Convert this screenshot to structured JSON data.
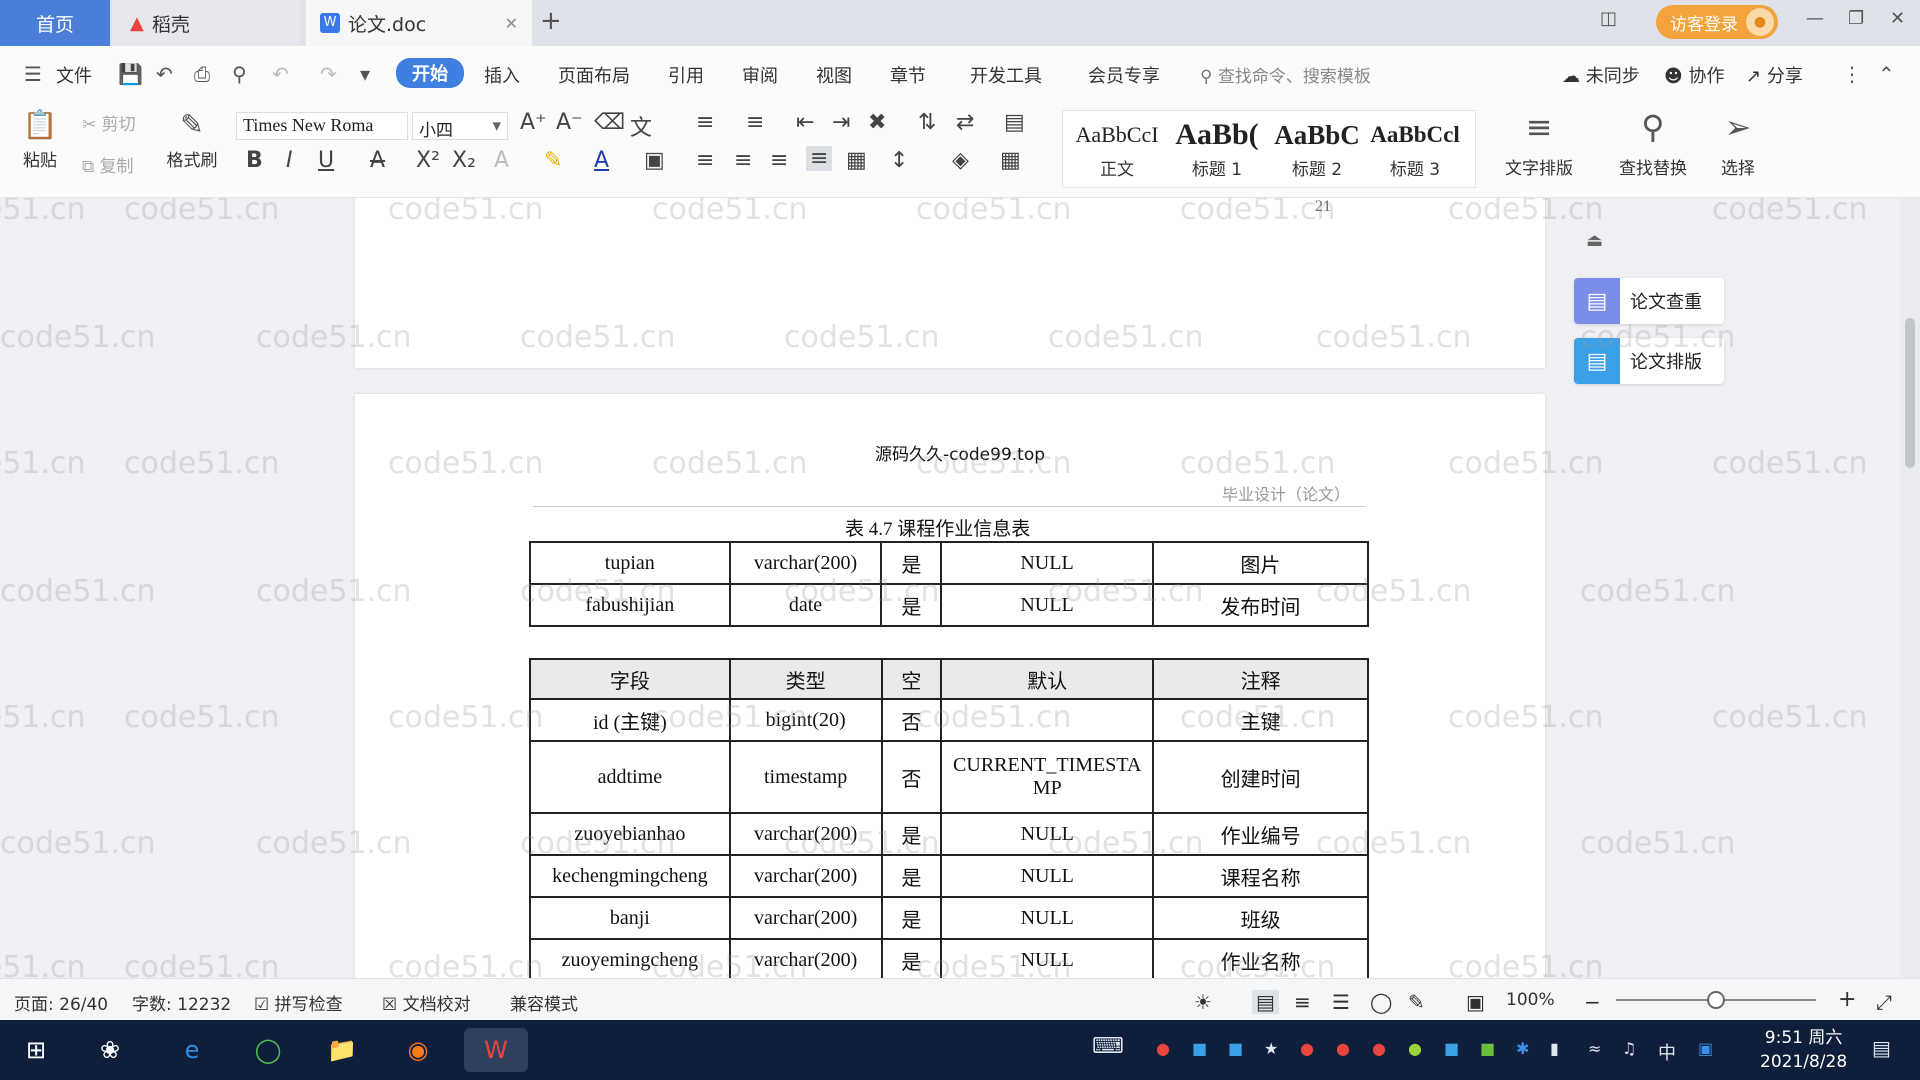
{
  "tabs": [
    {
      "label": "首页"
    },
    {
      "label": "稻壳"
    },
    {
      "label": "论文.doc"
    }
  ],
  "login_label": "访客登录",
  "menu": {
    "file": "文件",
    "items": [
      "开始",
      "插入",
      "页面布局",
      "引用",
      "审阅",
      "视图",
      "章节",
      "开发工具",
      "会员专享"
    ],
    "active": "开始",
    "search_placeholder": "查找命令、搜索模板",
    "sync": "未同步",
    "collab": "协作",
    "share": "分享"
  },
  "ribbon": {
    "paste": "粘贴",
    "cut": "剪切",
    "copy": "复制",
    "format_painter": "格式刷",
    "font_name": "Times New Roma",
    "font_size": "小四",
    "styles": [
      {
        "preview": "AaBbCcI",
        "name": "正文"
      },
      {
        "preview": "AaBb(",
        "name": "标题 1"
      },
      {
        "preview": "AaBbC",
        "name": "标题 2"
      },
      {
        "preview": "AaBbCcl",
        "name": "标题 3"
      }
    ],
    "text_layout": "文字排版",
    "find_replace": "查找替换",
    "select": "选择"
  },
  "document": {
    "page_number": "21",
    "header": "毕业设计（论文）",
    "overlay_text": "源码久久-code99.top",
    "watermark": "code51.cn",
    "top_table_rows": [
      [
        "tupian",
        "varchar(200)",
        "是",
        "NULL",
        "图片"
      ],
      [
        "fabushijian",
        "date",
        "是",
        "NULL",
        "发布时间"
      ]
    ],
    "caption": "表 4.7  课程作业信息表",
    "table_header": [
      "字段",
      "类型",
      "空",
      "默认",
      "注释"
    ],
    "table_rows": [
      [
        "id (主键)",
        "bigint(20)",
        "否",
        "",
        "主键"
      ],
      [
        "addtime",
        "timestamp",
        "否",
        "CURRENT_TIMESTAMP",
        "创建时间"
      ],
      [
        "zuoyebianhao",
        "varchar(200)",
        "是",
        "NULL",
        "作业编号"
      ],
      [
        "kechengmingcheng",
        "varchar(200)",
        "是",
        "NULL",
        "课程名称"
      ],
      [
        "banji",
        "varchar(200)",
        "是",
        "NULL",
        "班级"
      ],
      [
        "zuoyemingcheng",
        "varchar(200)",
        "是",
        "NULL",
        "作业名称"
      ]
    ],
    "default_line1": "CURRENT_TIMESTA",
    "default_line2": "MP"
  },
  "side_panel": {
    "check": "论文查重",
    "layout": "论文排版"
  },
  "status": {
    "page": "页面: 26/40",
    "words": "字数: 12232",
    "spell": "拼写检查",
    "proof": "文档校对",
    "compat": "兼容模式",
    "zoom": "100%",
    "zoom_level": 0.5
  },
  "taskbar": {
    "time": "9:51 周六",
    "date": "2021/8/28",
    "ime": "中"
  },
  "colors": {
    "accent": "#3e7fe0",
    "login": "#f2a33c",
    "taskbar": "#0f1e3a"
  }
}
